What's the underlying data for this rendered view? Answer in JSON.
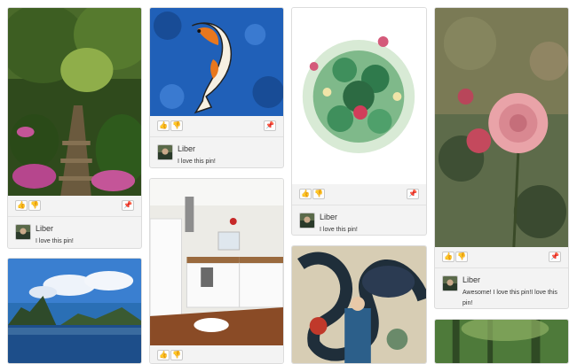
{
  "colors": {
    "card_bg": "#f3f3f3",
    "border": "#dcdcdc",
    "text": "#333333"
  },
  "icons": {
    "like": "thumbs-up-icon",
    "dislike": "thumbs-down-icon",
    "pin": "pushpin-icon"
  },
  "pins": [
    {
      "user": "Liber",
      "comment": "I love this pin!"
    },
    {
      "user": "Liber",
      "comment": "I love this pin!"
    },
    {
      "user": "Liber",
      "comment": "I love this pin!"
    },
    {
      "user": "Liber",
      "comment": "Awesome! I love this pin!I love this pin!"
    }
  ]
}
